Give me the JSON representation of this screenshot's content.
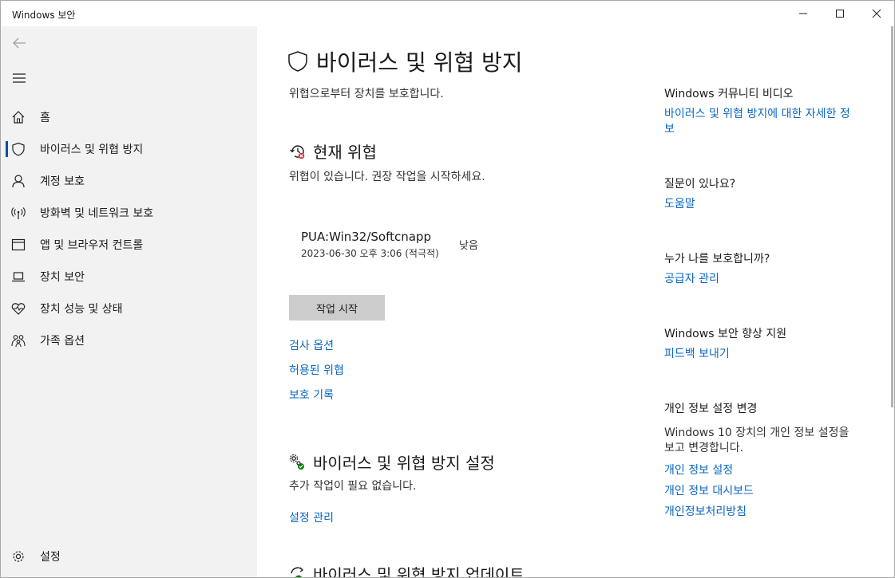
{
  "window": {
    "title": "Windows 보안"
  },
  "sidebar": {
    "items": [
      {
        "label": "홈"
      },
      {
        "label": "바이러스 및 위협 방지"
      },
      {
        "label": "계정 보호"
      },
      {
        "label": "방화벽 및 네트워크 보호"
      },
      {
        "label": "앱 및 브라우저 컨트롤"
      },
      {
        "label": "장치 보안"
      },
      {
        "label": "장치 성능 및 상태"
      },
      {
        "label": "가족 옵션"
      }
    ],
    "settings_label": "설정"
  },
  "main": {
    "title": "바이러스 및 위협 방지",
    "subtitle": "위협으로부터 장치를 보호합니다.",
    "current_threats": {
      "heading": "현재 위협",
      "desc": "위협이 있습니다. 권장 작업을 시작하세요.",
      "threat": {
        "name": "PUA:Win32/Softcnapp",
        "date": "2023-06-30 오후 3:06 (적극적)",
        "severity": "낮음"
      },
      "start_button": "작업 시작",
      "links": [
        "검사 옵션",
        "허용된 위협",
        "보호 기록"
      ]
    },
    "settings_section": {
      "heading": "바이러스 및 위협 방지 설정",
      "desc": "추가 작업이 필요 없습니다.",
      "link": "설정 관리"
    },
    "updates_section": {
      "heading": "바이러스 및 위협 방지 업데이트"
    }
  },
  "right": {
    "video": {
      "heading": "Windows 커뮤니티 비디오",
      "link": "바이러스 및 위협 방지에 대한 자세한 정보"
    },
    "question": {
      "heading": "질문이 있나요?",
      "link": "도움말"
    },
    "who": {
      "heading": "누가 나를 보호합니까?",
      "link": "공급자 관리"
    },
    "improve": {
      "heading": "Windows 보안 향상 지원",
      "link": "피드백 보내기"
    },
    "privacy": {
      "heading": "개인 정보 설정 변경",
      "text": "Windows 10 장치의 개인 정보 설정을 보고 변경합니다.",
      "links": [
        "개인 정보 설정",
        "개인 정보 대시보드",
        "개인정보처리방침"
      ]
    }
  },
  "colors": {
    "accent": "#0a66c2",
    "sidebar_bg": "#f2f2f2",
    "button_bg": "#cccccc",
    "alert_red": "#d13438",
    "ok_green": "#107c10"
  }
}
